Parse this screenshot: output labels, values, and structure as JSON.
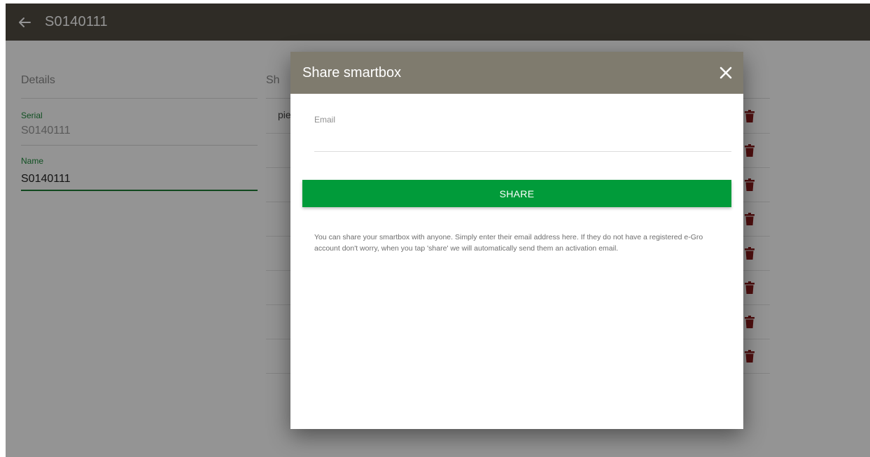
{
  "appbar": {
    "title": "S0140111"
  },
  "details": {
    "heading": "Details",
    "serial_label": "Serial",
    "serial_value": "S0140111",
    "name_label": "Name",
    "name_value": "S0140111"
  },
  "shared": {
    "heading": "Sh",
    "rows": [
      {
        "email": "pie"
      },
      {
        "email": ""
      },
      {
        "email": ""
      },
      {
        "email": ""
      },
      {
        "email": ""
      },
      {
        "email": ""
      },
      {
        "email": ""
      },
      {
        "email": ""
      }
    ]
  },
  "modal": {
    "title": "Share smartbox",
    "email_label": "Email",
    "email_value": "",
    "share_label": "SHARE",
    "help_text": "You can share your smartbox with anyone. Simply enter their email address here. If they do not have a registered e-Gro account don't worry, when you tap 'share' we will automatically send them an activation email."
  },
  "colors": {
    "appbar": "#524d43",
    "modal_header": "#7f7b6e",
    "accent_green": "#019b3a",
    "field_green": "#1e8a3c",
    "trash_red": "#8b1a1a"
  },
  "icons": {
    "back": "arrow-left-icon",
    "close": "close-icon",
    "delete": "trash-icon"
  }
}
